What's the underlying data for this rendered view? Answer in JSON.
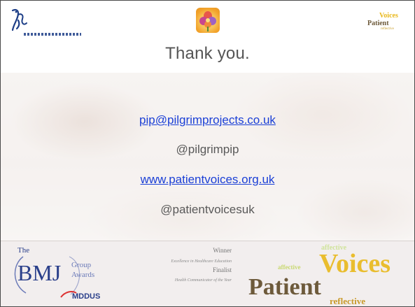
{
  "slide": {
    "title": "Thank you.",
    "contacts": {
      "email": "pip@pilgrimprojects.co.uk",
      "twitter_pip": "@pilgrimpip",
      "website": "www.patientvoices.org.uk",
      "twitter_pv": "@patientvoicesuk"
    }
  },
  "logos": {
    "pilgrim_projects": {
      "icon": "pilgrim-projects-logo"
    },
    "flower": {
      "icon": "flower-logo"
    },
    "patient_voices_small": {
      "icon": "patient-voices-logo",
      "word_voices": "Voices",
      "word_patient": "Patient",
      "word_reflective": "reflective"
    }
  },
  "footer": {
    "bmj_awards": {
      "the": "The",
      "bmj": "BMJ",
      "group": "Group",
      "awards": "Awards"
    },
    "medus": "MDDUS",
    "award_text": {
      "winner": "Winner",
      "winner_category": "Excellence in Healthcare Education",
      "finalist": "Finalist",
      "finalist_category": "Health Communicator of the Year"
    },
    "patient_voices": {
      "affective_top": "affective",
      "affective_left": "affective",
      "voices": "Voices",
      "patient": "Patient",
      "reflective": "reflective"
    }
  },
  "colors": {
    "link": "#1a3fd6",
    "text_gray": "#595959",
    "title_gray": "#555555",
    "bmj_blue": "#2a3f8a",
    "voices_gold": "#e9b81a",
    "patient_brown": "#6d5a3b"
  }
}
